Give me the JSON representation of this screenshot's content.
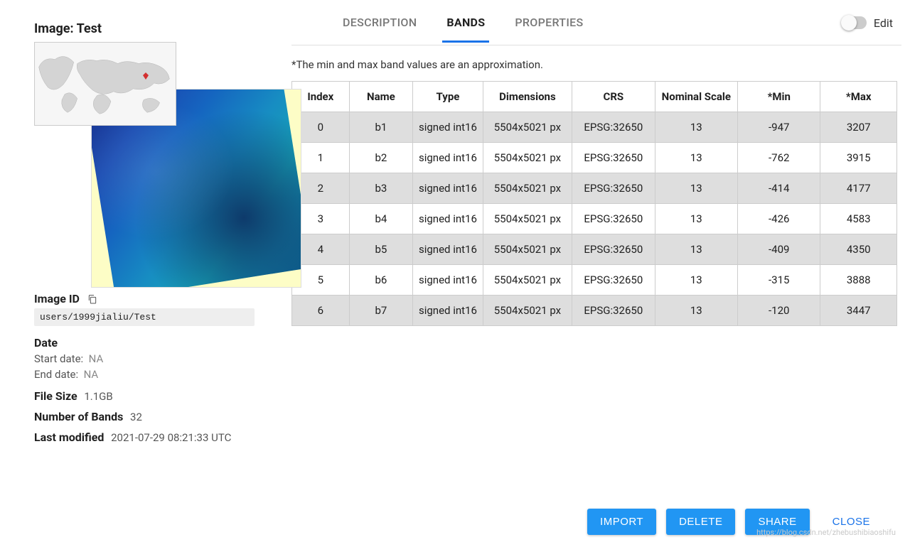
{
  "title": "Image: Test",
  "image_id_label": "Image ID",
  "image_id": "users/1999jialiu/Test",
  "date": {
    "heading": "Date",
    "start_label": "Start date:",
    "start_value": "NA",
    "end_label": "End date:",
    "end_value": "NA"
  },
  "file_size": {
    "label": "File Size",
    "value": "1.1GB"
  },
  "num_bands": {
    "label": "Number of Bands",
    "value": "32"
  },
  "last_modified": {
    "label": "Last modified",
    "value": "2021-07-29 08:21:33 UTC"
  },
  "tabs": {
    "description": "DESCRIPTION",
    "bands": "BANDS",
    "properties": "PROPERTIES",
    "active": "bands"
  },
  "edit": {
    "label": "Edit",
    "on": false
  },
  "note": "*The min and max band values are an approximation.",
  "table": {
    "headers": {
      "index": "Index",
      "name": "Name",
      "type": "Type",
      "dimensions": "Dimensions",
      "crs": "CRS",
      "scale": "Nominal Scale",
      "min": "*Min",
      "max": "*Max"
    },
    "rows": [
      {
        "index": "0",
        "name": "b1",
        "type": "signed int16",
        "dim": "5504x5021 px",
        "crs": "EPSG:32650",
        "scale": "13",
        "min": "-947",
        "max": "3207"
      },
      {
        "index": "1",
        "name": "b2",
        "type": "signed int16",
        "dim": "5504x5021 px",
        "crs": "EPSG:32650",
        "scale": "13",
        "min": "-762",
        "max": "3915"
      },
      {
        "index": "2",
        "name": "b3",
        "type": "signed int16",
        "dim": "5504x5021 px",
        "crs": "EPSG:32650",
        "scale": "13",
        "min": "-414",
        "max": "4177"
      },
      {
        "index": "3",
        "name": "b4",
        "type": "signed int16",
        "dim": "5504x5021 px",
        "crs": "EPSG:32650",
        "scale": "13",
        "min": "-426",
        "max": "4583"
      },
      {
        "index": "4",
        "name": "b5",
        "type": "signed int16",
        "dim": "5504x5021 px",
        "crs": "EPSG:32650",
        "scale": "13",
        "min": "-409",
        "max": "4350"
      },
      {
        "index": "5",
        "name": "b6",
        "type": "signed int16",
        "dim": "5504x5021 px",
        "crs": "EPSG:32650",
        "scale": "13",
        "min": "-315",
        "max": "3888"
      },
      {
        "index": "6",
        "name": "b7",
        "type": "signed int16",
        "dim": "5504x5021 px",
        "crs": "EPSG:32650",
        "scale": "13",
        "min": "-120",
        "max": "3447"
      }
    ]
  },
  "footer": {
    "import": "IMPORT",
    "delete": "DELETE",
    "share": "SHARE",
    "close": "CLOSE"
  },
  "watermark": "https://blog.csdn.net/zhebushibiaoshifu"
}
